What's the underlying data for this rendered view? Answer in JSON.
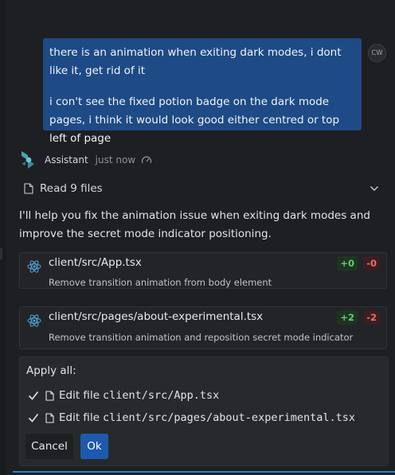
{
  "user_message": {
    "paragraphs": [
      "there is an animation when exiting dark modes, i dont like it, get rid of it",
      "i con't see the fixed potion badge on the dark mode pages, i think it would look good either centred or top left of page"
    ],
    "avatar_initials": "CW"
  },
  "assistant": {
    "name": "Assistant",
    "timestamp": "just now",
    "logo_icon": "assistant-logo-icon",
    "status_icon": "gauge-icon"
  },
  "read_files": {
    "label": "Read 9 files",
    "icon": "file-icon",
    "toggle_icon": "chevron-down-icon"
  },
  "intro_text": "I'll help you fix the animation issue when exiting dark modes and improve the secret mode indicator positioning.",
  "changes": [
    {
      "path": "client/src/App.tsx",
      "description": "Remove transition animation from body element",
      "additions": "+0",
      "deletions": "-0"
    },
    {
      "path": "client/src/pages/about-experimental.tsx",
      "description": "Remove transition animation and reposition secret mode indicator",
      "additions": "+2",
      "deletions": "-2"
    }
  ],
  "apply": {
    "title": "Apply all:",
    "items": [
      {
        "action": "Edit file",
        "path": "client/src/App.tsx",
        "checked": true
      },
      {
        "action": "Edit file",
        "path": "client/src/pages/about-experimental.tsx",
        "checked": true
      }
    ],
    "cancel_label": "Cancel",
    "ok_label": "Ok"
  },
  "colors": {
    "background": "#1e1f22",
    "user_bubble": "#1e4a85",
    "accent_button": "#1d59ad",
    "additions": "#5ecf6f",
    "deletions": "#f06c6c",
    "react_icon": "#4fa6d8"
  }
}
